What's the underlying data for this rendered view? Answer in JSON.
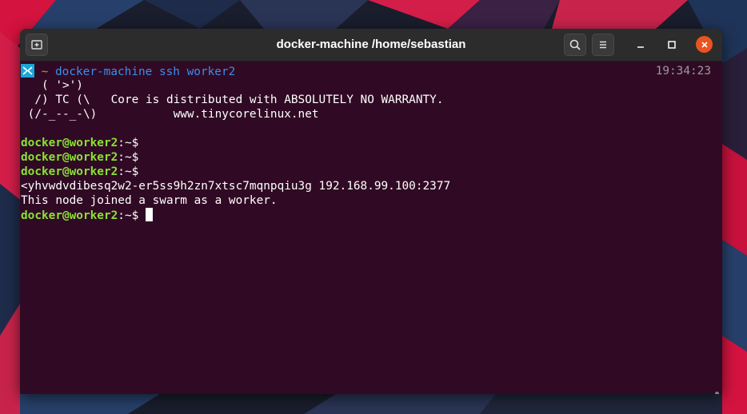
{
  "window": {
    "title": "docker-machine /home/sebastian"
  },
  "terminal": {
    "prompt_line": {
      "tilde": "~",
      "command": "docker-machine",
      "args": "ssh worker2",
      "time": "19:34:23"
    },
    "banner": [
      "   ( '>')",
      "  /) TC (\\   Core is distributed with ABSOLUTELY NO WARRANTY.",
      " (/-_--_-\\)           www.tinycorelinux.net"
    ],
    "prompts": [
      {
        "user": "docker@worker2",
        "sep": ":~$",
        "text": ""
      },
      {
        "user": "docker@worker2",
        "sep": ":~$",
        "text": ""
      },
      {
        "user": "docker@worker2",
        "sep": ":~$",
        "text": ""
      }
    ],
    "output": [
      "<yhvwdvdibesq2w2-er5ss9h2zn7xtsc7mqnpqiu3g 192.168.99.100:2377",
      "This node joined a swarm as a worker."
    ],
    "final_prompt": {
      "user": "docker@worker2",
      "sep": ":~$ "
    }
  },
  "icons": {
    "new_tab": "new-tab-icon",
    "search": "search-icon",
    "menu": "hamburger-menu-icon",
    "minimize": "minimize-icon",
    "maximize": "maximize-icon",
    "close": "close-icon",
    "prompt_badge": "vscode-badge-icon"
  },
  "colors": {
    "terminal_bg": "#300a24",
    "prompt_green": "#8ae234",
    "close_orange": "#e95420"
  }
}
